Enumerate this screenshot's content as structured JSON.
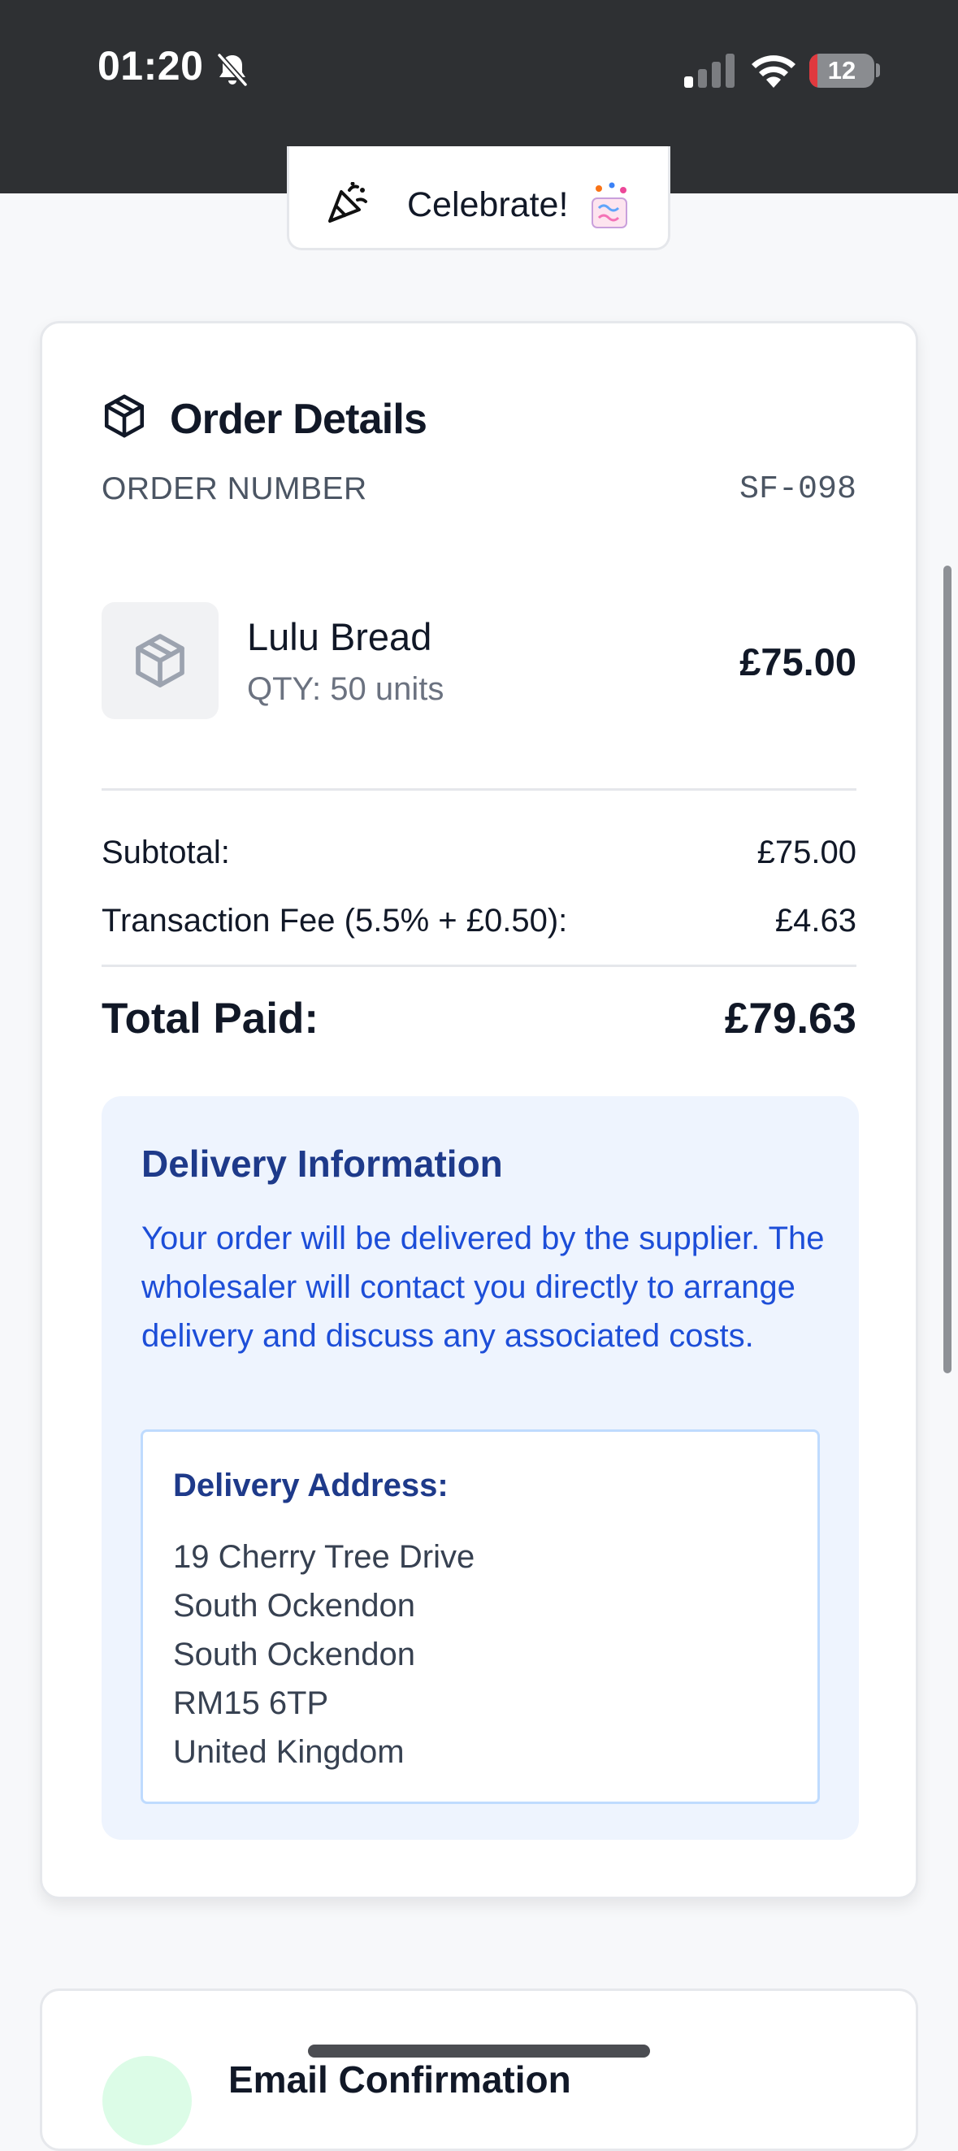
{
  "status_bar": {
    "time": "01:20",
    "battery_level": "12",
    "battery_fraction": 0.12,
    "icons": [
      "bell-slash-icon",
      "cellular-signal-icon",
      "wifi-icon",
      "battery-icon"
    ],
    "battery_color": "#e0393e"
  },
  "browser": {
    "url": "quikpik.app"
  },
  "celebrate": {
    "label": "Celebrate!",
    "icons": [
      "party-popper-icon",
      "confetti-emoji-icon"
    ]
  },
  "order": {
    "title": "Order Details",
    "title_icon": "package-icon",
    "order_number_label": "ORDER NUMBER",
    "order_number": "SF-098",
    "item": {
      "name": "Lulu Bread",
      "qty": "QTY: 50 units",
      "price": "£75.00",
      "thumb_icon": "package-icon"
    },
    "subtotal_label": "Subtotal:",
    "subtotal_value": "£75.00",
    "fee_label": "Transaction Fee (5.5% + £0.50):",
    "fee_value": "£4.63",
    "total_label": "Total Paid:",
    "total_value": "£79.63"
  },
  "delivery": {
    "title": "Delivery Information",
    "text": "Your order will be delivered by the supplier. The wholesaler will contact you directly to arrange delivery and discuss any associated costs.",
    "address_title": "Delivery Address:",
    "address_lines": [
      "19 Cherry Tree Drive",
      "South Ockendon",
      "South Ockendon",
      "RM15 6TP",
      "United Kingdom"
    ],
    "panel_color": "#eef4fe",
    "text_color": "#1d4ed8"
  },
  "email": {
    "title": "Email Confirmation"
  }
}
